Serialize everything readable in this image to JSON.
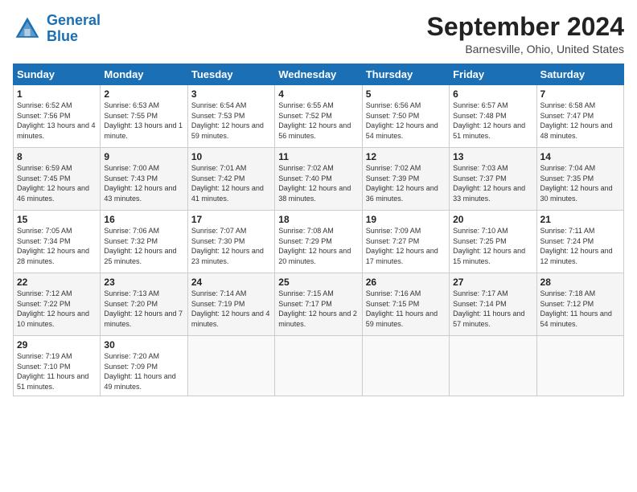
{
  "header": {
    "logo_line1": "General",
    "logo_line2": "Blue",
    "month_title": "September 2024",
    "location": "Barnesville, Ohio, United States"
  },
  "weekdays": [
    "Sunday",
    "Monday",
    "Tuesday",
    "Wednesday",
    "Thursday",
    "Friday",
    "Saturday"
  ],
  "weeks": [
    [
      {
        "day": "1",
        "sunrise": "Sunrise: 6:52 AM",
        "sunset": "Sunset: 7:56 PM",
        "daylight": "Daylight: 13 hours and 4 minutes."
      },
      {
        "day": "2",
        "sunrise": "Sunrise: 6:53 AM",
        "sunset": "Sunset: 7:55 PM",
        "daylight": "Daylight: 13 hours and 1 minute."
      },
      {
        "day": "3",
        "sunrise": "Sunrise: 6:54 AM",
        "sunset": "Sunset: 7:53 PM",
        "daylight": "Daylight: 12 hours and 59 minutes."
      },
      {
        "day": "4",
        "sunrise": "Sunrise: 6:55 AM",
        "sunset": "Sunset: 7:52 PM",
        "daylight": "Daylight: 12 hours and 56 minutes."
      },
      {
        "day": "5",
        "sunrise": "Sunrise: 6:56 AM",
        "sunset": "Sunset: 7:50 PM",
        "daylight": "Daylight: 12 hours and 54 minutes."
      },
      {
        "day": "6",
        "sunrise": "Sunrise: 6:57 AM",
        "sunset": "Sunset: 7:48 PM",
        "daylight": "Daylight: 12 hours and 51 minutes."
      },
      {
        "day": "7",
        "sunrise": "Sunrise: 6:58 AM",
        "sunset": "Sunset: 7:47 PM",
        "daylight": "Daylight: 12 hours and 48 minutes."
      }
    ],
    [
      {
        "day": "8",
        "sunrise": "Sunrise: 6:59 AM",
        "sunset": "Sunset: 7:45 PM",
        "daylight": "Daylight: 12 hours and 46 minutes."
      },
      {
        "day": "9",
        "sunrise": "Sunrise: 7:00 AM",
        "sunset": "Sunset: 7:43 PM",
        "daylight": "Daylight: 12 hours and 43 minutes."
      },
      {
        "day": "10",
        "sunrise": "Sunrise: 7:01 AM",
        "sunset": "Sunset: 7:42 PM",
        "daylight": "Daylight: 12 hours and 41 minutes."
      },
      {
        "day": "11",
        "sunrise": "Sunrise: 7:02 AM",
        "sunset": "Sunset: 7:40 PM",
        "daylight": "Daylight: 12 hours and 38 minutes."
      },
      {
        "day": "12",
        "sunrise": "Sunrise: 7:02 AM",
        "sunset": "Sunset: 7:39 PM",
        "daylight": "Daylight: 12 hours and 36 minutes."
      },
      {
        "day": "13",
        "sunrise": "Sunrise: 7:03 AM",
        "sunset": "Sunset: 7:37 PM",
        "daylight": "Daylight: 12 hours and 33 minutes."
      },
      {
        "day": "14",
        "sunrise": "Sunrise: 7:04 AM",
        "sunset": "Sunset: 7:35 PM",
        "daylight": "Daylight: 12 hours and 30 minutes."
      }
    ],
    [
      {
        "day": "15",
        "sunrise": "Sunrise: 7:05 AM",
        "sunset": "Sunset: 7:34 PM",
        "daylight": "Daylight: 12 hours and 28 minutes."
      },
      {
        "day": "16",
        "sunrise": "Sunrise: 7:06 AM",
        "sunset": "Sunset: 7:32 PM",
        "daylight": "Daylight: 12 hours and 25 minutes."
      },
      {
        "day": "17",
        "sunrise": "Sunrise: 7:07 AM",
        "sunset": "Sunset: 7:30 PM",
        "daylight": "Daylight: 12 hours and 23 minutes."
      },
      {
        "day": "18",
        "sunrise": "Sunrise: 7:08 AM",
        "sunset": "Sunset: 7:29 PM",
        "daylight": "Daylight: 12 hours and 20 minutes."
      },
      {
        "day": "19",
        "sunrise": "Sunrise: 7:09 AM",
        "sunset": "Sunset: 7:27 PM",
        "daylight": "Daylight: 12 hours and 17 minutes."
      },
      {
        "day": "20",
        "sunrise": "Sunrise: 7:10 AM",
        "sunset": "Sunset: 7:25 PM",
        "daylight": "Daylight: 12 hours and 15 minutes."
      },
      {
        "day": "21",
        "sunrise": "Sunrise: 7:11 AM",
        "sunset": "Sunset: 7:24 PM",
        "daylight": "Daylight: 12 hours and 12 minutes."
      }
    ],
    [
      {
        "day": "22",
        "sunrise": "Sunrise: 7:12 AM",
        "sunset": "Sunset: 7:22 PM",
        "daylight": "Daylight: 12 hours and 10 minutes."
      },
      {
        "day": "23",
        "sunrise": "Sunrise: 7:13 AM",
        "sunset": "Sunset: 7:20 PM",
        "daylight": "Daylight: 12 hours and 7 minutes."
      },
      {
        "day": "24",
        "sunrise": "Sunrise: 7:14 AM",
        "sunset": "Sunset: 7:19 PM",
        "daylight": "Daylight: 12 hours and 4 minutes."
      },
      {
        "day": "25",
        "sunrise": "Sunrise: 7:15 AM",
        "sunset": "Sunset: 7:17 PM",
        "daylight": "Daylight: 12 hours and 2 minutes."
      },
      {
        "day": "26",
        "sunrise": "Sunrise: 7:16 AM",
        "sunset": "Sunset: 7:15 PM",
        "daylight": "Daylight: 11 hours and 59 minutes."
      },
      {
        "day": "27",
        "sunrise": "Sunrise: 7:17 AM",
        "sunset": "Sunset: 7:14 PM",
        "daylight": "Daylight: 11 hours and 57 minutes."
      },
      {
        "day": "28",
        "sunrise": "Sunrise: 7:18 AM",
        "sunset": "Sunset: 7:12 PM",
        "daylight": "Daylight: 11 hours and 54 minutes."
      }
    ],
    [
      {
        "day": "29",
        "sunrise": "Sunrise: 7:19 AM",
        "sunset": "Sunset: 7:10 PM",
        "daylight": "Daylight: 11 hours and 51 minutes."
      },
      {
        "day": "30",
        "sunrise": "Sunrise: 7:20 AM",
        "sunset": "Sunset: 7:09 PM",
        "daylight": "Daylight: 11 hours and 49 minutes."
      },
      null,
      null,
      null,
      null,
      null
    ]
  ]
}
